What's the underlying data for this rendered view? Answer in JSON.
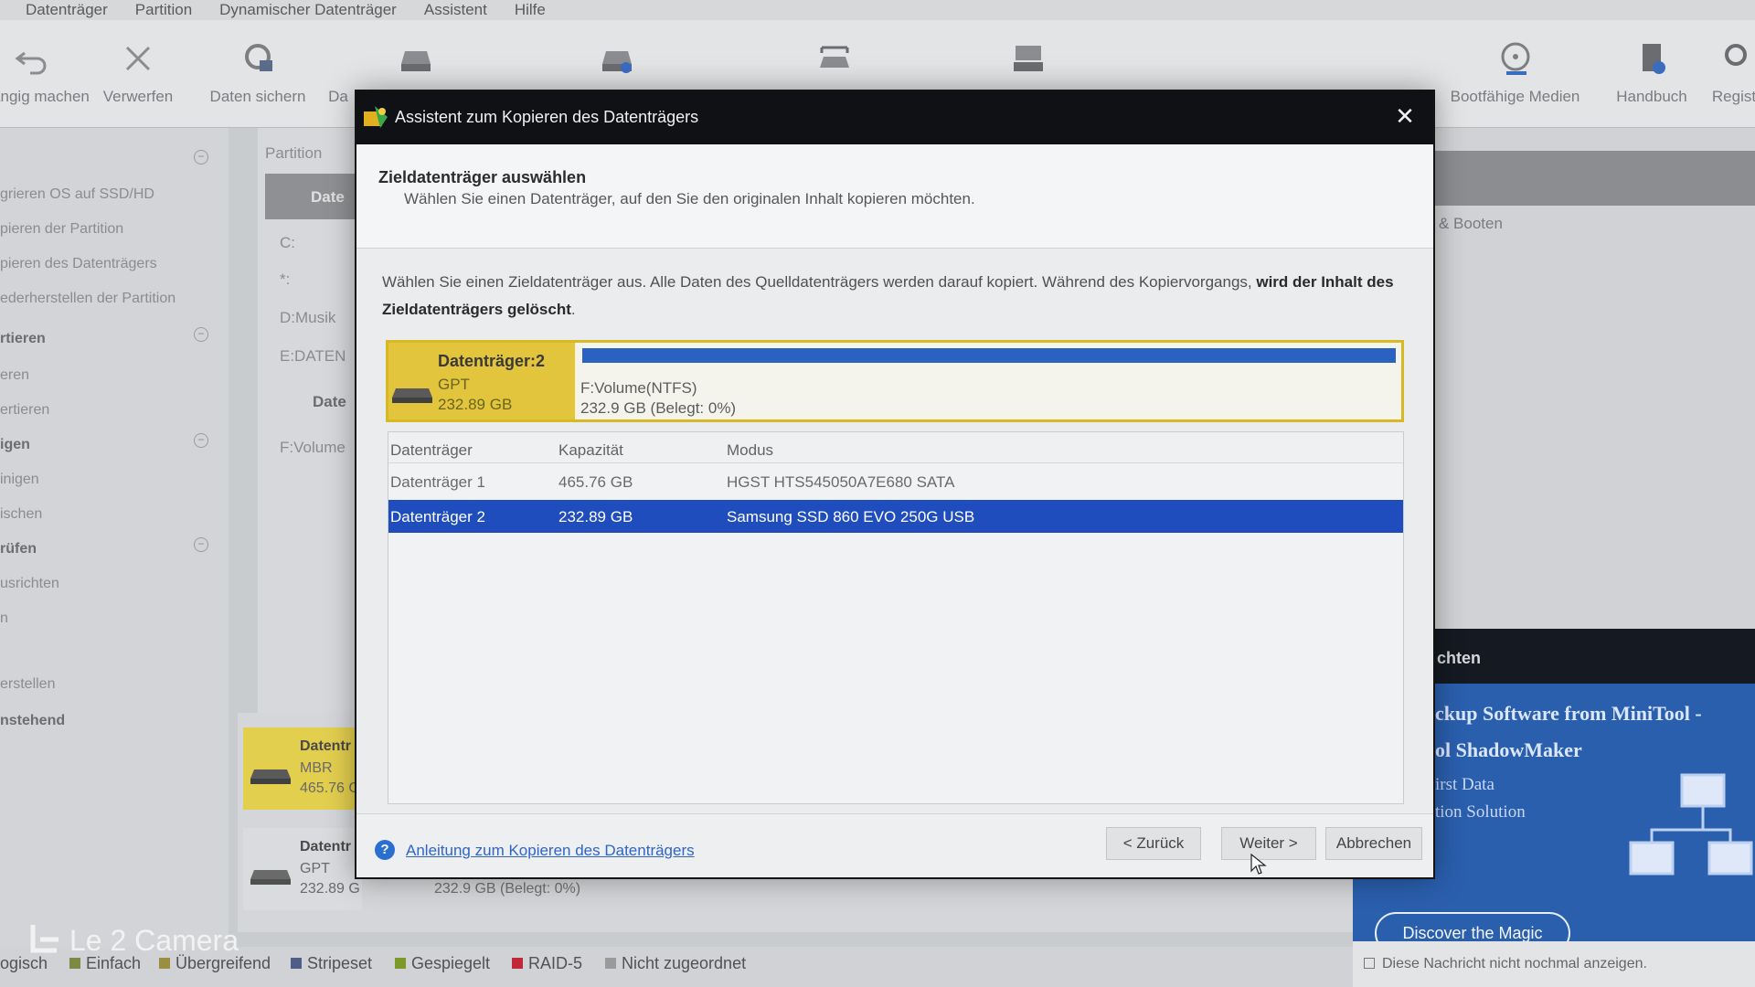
{
  "app": {
    "menu": [
      "Datenträger",
      "Partition",
      "Dynamischer Datenträger",
      "Assistent",
      "Hilfe"
    ],
    "toolbar": {
      "undo": "ngängig machen",
      "discard": "Verwerfen",
      "backup": "Daten sichern",
      "restore": "Da",
      "boot_media": "Bootfähige Medien",
      "manual": "Handbuch",
      "register": "Regist"
    },
    "sidebar": {
      "items": [
        "grieren OS auf SSD/HD",
        "pieren der Partition",
        "pieren des Datenträgers",
        "ederherstellen der Partition",
        "rtieren",
        "eren",
        "ertieren",
        "igen",
        "inigen",
        "ischen",
        "rüfen",
        "usrichten",
        "n",
        "erstellen",
        "nstehend"
      ]
    },
    "partition_column": {
      "header": "Partition",
      "sel": "Date",
      "c": "C:",
      "star": "*:",
      "d": "D:Musik",
      "e": "E:DATEN",
      "disk2": "Date",
      "f": "F:Volume"
    },
    "right_panel": {
      "text": "& Booten"
    },
    "ad": {
      "header": "chten",
      "line1": "ckup Software  from MiniTool  -",
      "line2": "ol ShadowMaker",
      "line3": "irst Data",
      "line4": "tion Solution",
      "button": "Discover the Magic",
      "checkbox_label": "Diese Nachricht nicht nochmal anzeigen."
    },
    "lower_disks": [
      {
        "name": "Datentr",
        "type": "MBR",
        "size": "465.76 G"
      },
      {
        "name": "Datentr",
        "type": "GPT",
        "size": "232.89 G",
        "extra": "232.9 GB (Belegt: 0%)"
      }
    ],
    "legend": {
      "logical": "ogisch",
      "items": [
        "Einfach",
        "Übergreifend",
        "Stripeset",
        "Gespiegelt",
        "RAID-5",
        "Nicht zugeordnet"
      ],
      "colors": [
        "#7d8a46",
        "#9a8e40",
        "#4f5d88",
        "#7c9a2a",
        "#c0283a",
        "#9a9a9a"
      ]
    },
    "camera_watermark": "Le 2 Camera"
  },
  "dialog": {
    "title": "Assistent zum Kopieren des Datenträgers",
    "close": "✕",
    "header_title": "Zieldatenträger auswählen",
    "header_subtitle": "Wählen Sie einen Datenträger, auf den Sie den originalen Inhalt kopieren möchten.",
    "info_normal": "Wählen Sie einen Zieldatenträger aus. Alle Daten des Quelldatenträgers werden darauf kopiert. Während des Kopiervorgangs, ",
    "info_bold": "wird der Inhalt des Zieldatenträgers gelöscht",
    "info_end": ".",
    "disk_preview": {
      "name": "Datenträger:2",
      "type": "GPT",
      "size": "232.89 GB",
      "partition_label": "F:Volume(NTFS)",
      "partition_info": "232.9 GB (Belegt: 0%)",
      "used_fraction": 0.0,
      "bar_color": "#2a62c1"
    },
    "table": {
      "columns": [
        "Datenträger",
        "Kapazität",
        "Modus"
      ],
      "rows": [
        {
          "disk": "Datenträger 1",
          "capacity": "465.76 GB",
          "mode": "HGST HTS545050A7E680 SATA",
          "selected": false
        },
        {
          "disk": "Datenträger 2",
          "capacity": "232.89 GB",
          "mode": "Samsung SSD 860 EVO 250G USB",
          "selected": true
        }
      ]
    },
    "footer": {
      "help_link": "Anleitung zum Kopieren des Datenträgers",
      "back": "< Zurück",
      "next": "Weiter >",
      "cancel": "Abbrechen"
    }
  }
}
